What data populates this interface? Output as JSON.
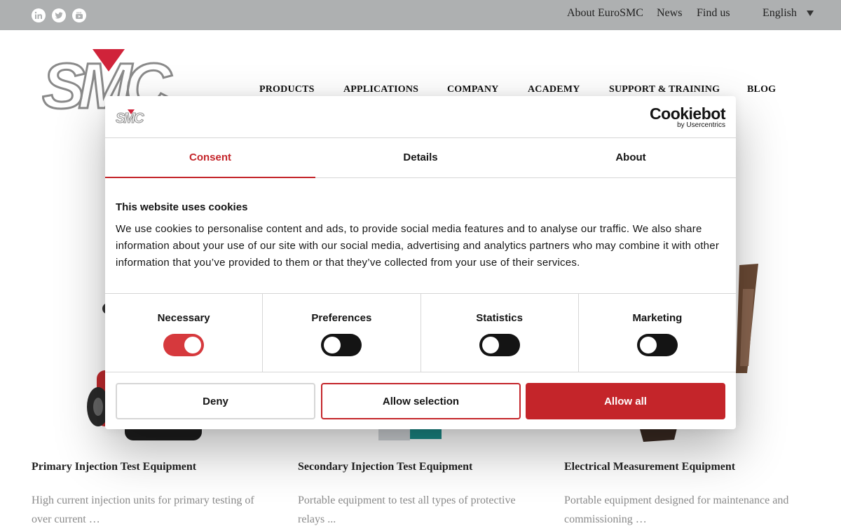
{
  "topbar": {
    "social_icons": [
      "linkedin-icon",
      "twitter-icon",
      "youtube-icon"
    ],
    "links": [
      "About EuroSMC",
      "News",
      "Find us"
    ],
    "language": "English"
  },
  "nav": [
    "PRODUCTS",
    "APPLICATIONS",
    "COMPANY",
    "ACADEMY",
    "SUPPORT & TRAINING",
    "BLOG"
  ],
  "colors": {
    "accent": "#c4252a",
    "topbar": "#aeb0b1",
    "logo_triangle": "#d0233a"
  },
  "products": [
    {
      "title": "Primary Injection Test Equipment",
      "desc": "High current injection units for primary testing of over current …"
    },
    {
      "title": "Secondary Injection Test Equipment",
      "desc": "Portable equipment to test all types of protective relays ..."
    },
    {
      "title": "Electrical Measurement Equipment",
      "desc": "Portable equipment designed for maintenance and commissioning …"
    }
  ],
  "cookie": {
    "brand": "Cookiebot",
    "brand_sub": "by Usercentrics",
    "tabs": [
      "Consent",
      "Details",
      "About"
    ],
    "active_tab": "Consent",
    "title": "This website uses cookies",
    "text": "We use cookies to personalise content and ads, to provide social media features and to analyse our traffic. We also share information about your use of our site with our social media, advertising and analytics partners who may combine it with other information that you’ve provided to them or that they’ve collected from your use of their services.",
    "toggles": [
      {
        "label": "Necessary",
        "on": true
      },
      {
        "label": "Preferences",
        "on": false
      },
      {
        "label": "Statistics",
        "on": false
      },
      {
        "label": "Marketing",
        "on": false
      }
    ],
    "buttons": {
      "deny": "Deny",
      "allow_selection": "Allow selection",
      "allow_all": "Allow all"
    }
  }
}
